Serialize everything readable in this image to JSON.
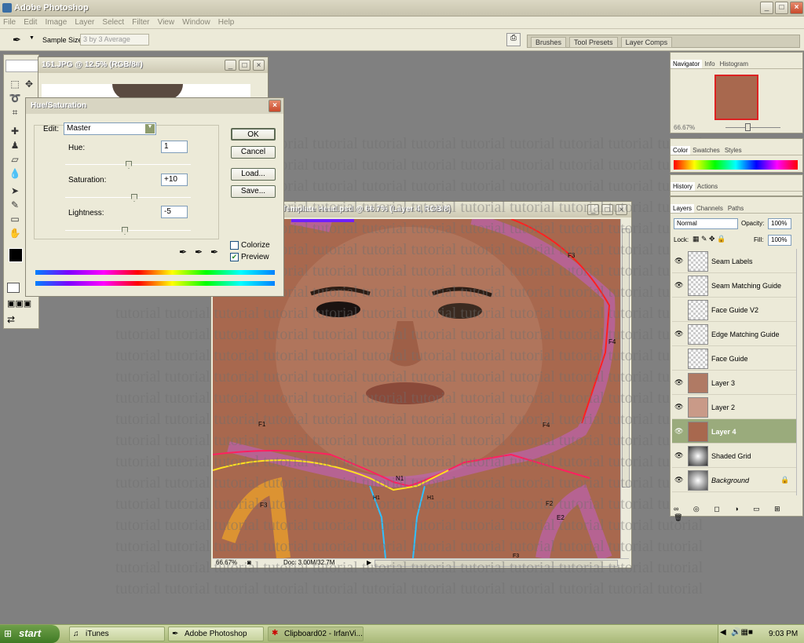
{
  "app": {
    "title": "Adobe Photoshop"
  },
  "menu": [
    "File",
    "Edit",
    "Image",
    "Layer",
    "Select",
    "Filter",
    "View",
    "Window",
    "Help"
  ],
  "options": {
    "sample_size_label": "Sample Size:",
    "sample_size_value": "3 by 3 Average"
  },
  "palette_well": [
    "Brushes",
    "Tool Presets",
    "Layer Comps"
  ],
  "doc_back": {
    "title": "161.JPG @ 12.5% (RGB/8#)"
  },
  "doc_main": {
    "title": "Template Head.psd @ 66.7% (Layer 4, RGB/8)",
    "zoom": "66.67%",
    "doc_size": "Doc: 3.00M/32.7M"
  },
  "overlay": {
    "word": "tutorial tutorial tutorial tutorial tutorial tutorial tutorial tutorial tutorial tutorial tutorial tutorial"
  },
  "seam_labels": [
    "F3",
    "F4",
    "F4",
    "F1",
    "N1",
    "H1",
    "H1",
    "F3",
    "F2",
    "E2",
    "F3"
  ],
  "hue_dialog": {
    "title": "Hue/Saturation",
    "edit_label": "Edit:",
    "edit_value": "Master",
    "hue_label": "Hue:",
    "hue_value": "1",
    "sat_label": "Saturation:",
    "sat_value": "+10",
    "light_label": "Lightness:",
    "light_value": "-5",
    "ok": "OK",
    "cancel": "Cancel",
    "load": "Load...",
    "save": "Save...",
    "colorize": "Colorize",
    "preview": "Preview",
    "hue_level": 1,
    "sat_level": 10,
    "light_level": -5,
    "preview_checked": true,
    "colorize_checked": false
  },
  "navigator": {
    "tabs": [
      "Navigator",
      "Info",
      "Histogram"
    ],
    "zoom": "66.67%"
  },
  "color_panel": {
    "tabs": [
      "Color",
      "Swatches",
      "Styles"
    ]
  },
  "history_panel": {
    "tabs": [
      "History",
      "Actions"
    ]
  },
  "layers_panel": {
    "tabs": [
      "Layers",
      "Channels",
      "Paths"
    ],
    "blend_mode": "Normal",
    "opacity_label": "Opacity:",
    "opacity": "100%",
    "lock_label": "Lock:",
    "fill_label": "Fill:",
    "fill": "100%",
    "layers": [
      {
        "name": "Seam Labels",
        "visible": true
      },
      {
        "name": "Seam Matching Guide",
        "visible": true
      },
      {
        "name": "Face Guide V2",
        "visible": false
      },
      {
        "name": "Edge Matching Guide",
        "visible": true
      },
      {
        "name": "Face Guide",
        "visible": false
      },
      {
        "name": "Layer 3",
        "visible": true
      },
      {
        "name": "Layer 2",
        "visible": true
      },
      {
        "name": "Layer 4",
        "visible": true,
        "selected": true
      },
      {
        "name": "Shaded Grid",
        "visible": true
      },
      {
        "name": "Background",
        "visible": true,
        "locked": true
      }
    ]
  },
  "taskbar": {
    "start": "start",
    "tasks": [
      "iTunes",
      "Adobe Photoshop",
      "Clipboard02 - IrfanVi..."
    ],
    "clock": "9:03 PM"
  },
  "colors": {
    "accent_layer": "#9aab7c",
    "skin": "#a8684e"
  }
}
